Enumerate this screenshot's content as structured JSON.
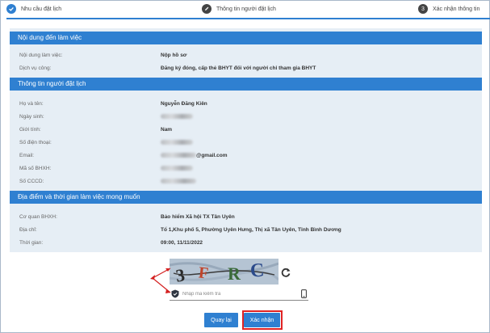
{
  "steps": [
    {
      "label": "Nhu cầu đặt lịch",
      "icon": "check-icon"
    },
    {
      "label": "Thông tin người đặt lịch",
      "icon": "pencil-icon"
    },
    {
      "number": "3",
      "label": "Xác nhận thông tin"
    }
  ],
  "sections": {
    "work": {
      "title": "Nội dung đến làm việc",
      "rows": [
        {
          "label": "Nội dung làm việc:",
          "value": "Nộp hồ sơ"
        },
        {
          "label": "Dịch vụ công:",
          "value": "Đăng ký đóng, cấp thẻ BHYT đối với người chỉ tham gia BHYT"
        }
      ]
    },
    "person": {
      "title": "Thông tin người đặt lịch",
      "rows": [
        {
          "label": "Họ và tên:",
          "value": "Nguyễn Đăng Kiên"
        },
        {
          "label": "Ngày sinh:",
          "value": ""
        },
        {
          "label": "Giới tính:",
          "value": "Nam"
        },
        {
          "label": "Số điện thoại:",
          "value": ""
        },
        {
          "label": "Email:",
          "value": "@gmail.com"
        },
        {
          "label": "Mã số BHXH:",
          "value": ""
        },
        {
          "label": "Số CCCD:",
          "value": ""
        }
      ]
    },
    "place": {
      "title": "Địa điểm và thời gian làm việc mong muốn",
      "rows": [
        {
          "label": "Cơ quan BHXH:",
          "value": "Bảo hiểm Xã hội TX Tân Uyên"
        },
        {
          "label": "Địa chỉ:",
          "value": "Tổ 1,Khu phố 5, Phường Uyên Hưng, Thị xã Tân Uyên, Tỉnh Bình Dương"
        },
        {
          "label": "Thời gian:",
          "value": "09:00, 11/11/2022"
        }
      ]
    }
  },
  "captcha": {
    "text": "3FRC",
    "placeholder": "Nhập mã kiểm tra",
    "value": ""
  },
  "buttons": {
    "back": "Quay lại",
    "confirm": "Xác nhận"
  },
  "colors": {
    "accent": "#2f80d1",
    "highlight": "#e02424",
    "panel": "#e6eef5"
  }
}
